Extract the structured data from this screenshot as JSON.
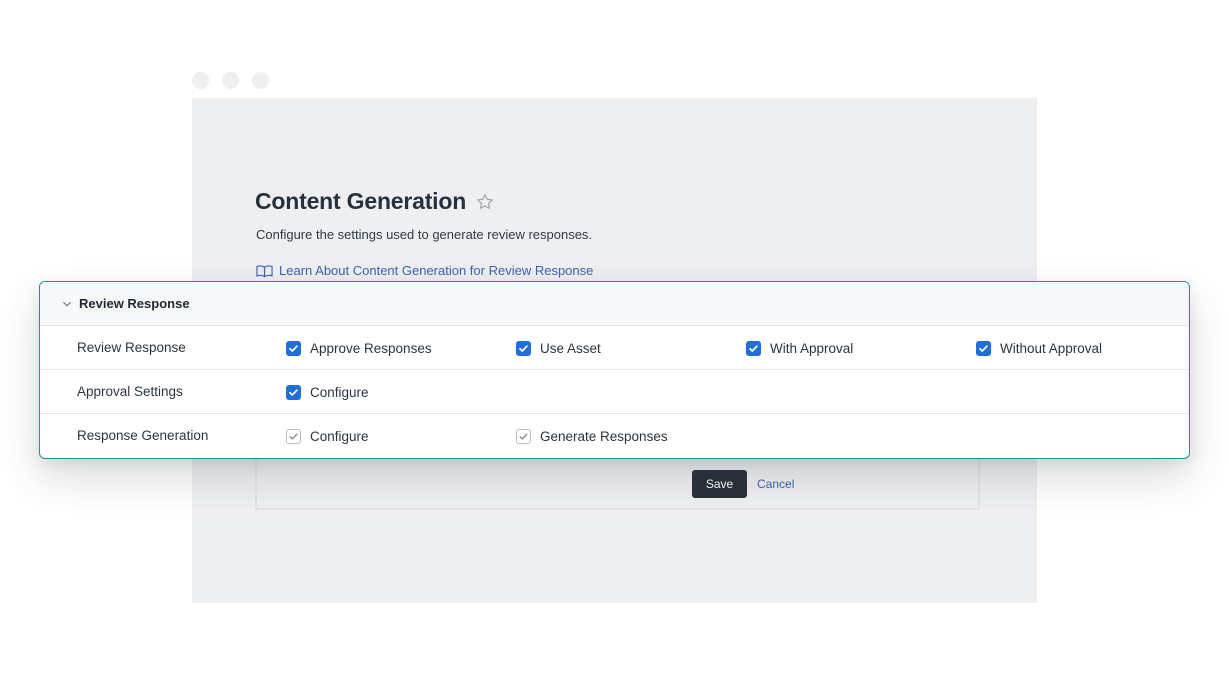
{
  "page": {
    "title": "Content Generation",
    "subtitle": "Configure the settings used to generate review responses.",
    "learn_link": "Learn About Content Generation for Review Response"
  },
  "actions": {
    "save": "Save",
    "cancel": "Cancel"
  },
  "panel": {
    "header": "Review Response",
    "rows": [
      {
        "label": "Review Response",
        "options": [
          {
            "label": "Approve Responses",
            "checked": true,
            "disabled": false
          },
          {
            "label": "Use Asset",
            "checked": true,
            "disabled": false
          },
          {
            "label": "With Approval",
            "checked": true,
            "disabled": false
          },
          {
            "label": "Without Approval",
            "checked": true,
            "disabled": false
          }
        ]
      },
      {
        "label": "Approval Settings",
        "options": [
          {
            "label": "Configure",
            "checked": true,
            "disabled": false
          }
        ]
      },
      {
        "label": "Response Generation",
        "options": [
          {
            "label": "Configure",
            "checked": true,
            "disabled": true
          },
          {
            "label": "Generate Responses",
            "checked": true,
            "disabled": true
          }
        ]
      }
    ]
  },
  "icons": {
    "favorite": "star-outline-icon",
    "learn": "book-icon",
    "collapse": "chevron-down-icon",
    "check": "checkmark-icon"
  },
  "colors": {
    "accent": "#1f6fd6",
    "link": "#3c63b5",
    "card_border": "#2b8a9c",
    "save_button": "#2b3139"
  }
}
